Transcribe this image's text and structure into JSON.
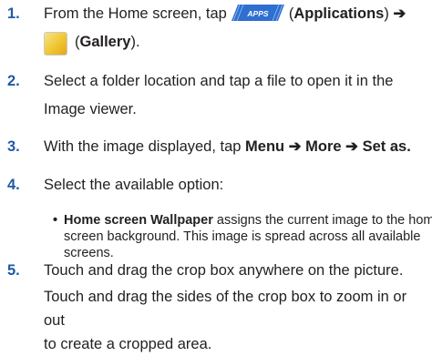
{
  "steps": [
    {
      "number": "1.",
      "text_before": "From the Home screen, tap",
      "apps_icon_label": "APPS",
      "applications_paren_open": "(",
      "applications_label": "Applications",
      "applications_paren_close": ")",
      "arrow": "➔",
      "gallery_paren_open": "(",
      "gallery_label": "Gallery",
      "gallery_paren_close": ")."
    },
    {
      "number": "2.",
      "line1": "Select a folder location and tap a file to open it in the",
      "line2": "Image viewer."
    },
    {
      "number": "3.",
      "text_before": "With the image displayed, tap",
      "menu": "Menu",
      "arrow1": "➔",
      "more": "More",
      "arrow2": "➔",
      "set_as": "Set as."
    },
    {
      "number": "4.",
      "text": "Select the available option:",
      "bullet": {
        "mark": "•",
        "bold_label": "Home screen Wallpaper",
        "line1_rest": "assigns the current image to the home",
        "line2": "screen background. This image is spread across all available",
        "line3": "screens."
      }
    },
    {
      "number": "5.",
      "line1": "Touch and drag the crop box anywhere on the picture.",
      "line2": "Touch and drag the sides of the crop box to zoom in or out",
      "line3": "to create a cropped area."
    }
  ],
  "colors": {
    "step_number": "#1f5aa6",
    "apps_icon_fill": "#2e6fd0",
    "text": "#231f20"
  },
  "icons": {
    "apps": "apps-icon",
    "gallery": "gallery-icon"
  }
}
